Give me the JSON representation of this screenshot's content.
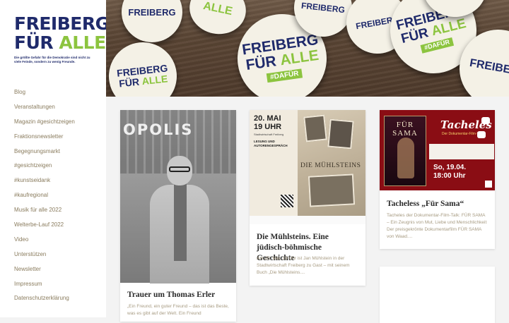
{
  "logo": {
    "line1": "FREIBERG",
    "line2_a": "FÜR",
    "line2_b": "ALLE",
    "tagline": "Die größte Gefahr für die Demokratie sind nicht zu viele Feinde, sondern zu wenig Freunde.",
    "colors": {
      "navy": "#1f2a6b",
      "green": "#8cc43f"
    }
  },
  "nav": {
    "items": [
      "Blog",
      "Veranstaltungen",
      "Magazin #gesichtzeigen",
      "Fraktionsnewsletter",
      "Begegnungsmarkt",
      "#gesichtzeigen",
      "#kunstseidank",
      "#kaufregional",
      "Musik für alle 2022",
      "Welterbe-Lauf 2022",
      "Video",
      "Unterstützen",
      "Newsletter",
      "Impressum",
      "Datenschutzerklärung"
    ],
    "color": "#8a7c5e"
  },
  "hero": {
    "badge_line1": "FREIBERG",
    "badge_line2a": "FÜR",
    "badge_line2b": "ALLE",
    "badge_tag": "#DAFÜR"
  },
  "cards": [
    {
      "title": "Trauer um Thomas Erler",
      "excerpt": "„Ein Freund, ein guter Freund – das ist das Beste, was es gibt auf der Welt. Ein Freund",
      "image": {
        "sign": "OPOLIS"
      }
    },
    {
      "title": "Die Mühlsteins. Eine jüdisch-böhmische Geschichte",
      "excerpt": "Am 20. Mai, 19 Uhr ist Jan Mühlstein in der Stadtwirtschaft Freiberg zu Gast – mit seinem Buch „Die Mühlsteins....",
      "image": {
        "date": "20. MAI",
        "time": "19 UHR",
        "place": "Stadtwirtschaft Freiberg",
        "heading": "LESUNG UND AUTORENGESPRÄCH",
        "title": "DIE MÜHLSTEINS"
      }
    },
    {
      "title": "Tacheless „Für Sama“",
      "excerpt": "Tacheles der Dokumentar-Film-Talk: FÜR SAMA – Ein Zeugnis von Mut, Liebe und Menschlichkeit Der preisgekrönte Dokumentarfilm FÜR SAMA von Waad....",
      "image": {
        "film": "FÜR SAMA",
        "series": "Tacheles",
        "subtitle": "Der Dokumentar-Film-Talk",
        "date": "So, 19.04.",
        "time": "18:00 Uhr"
      }
    }
  ]
}
